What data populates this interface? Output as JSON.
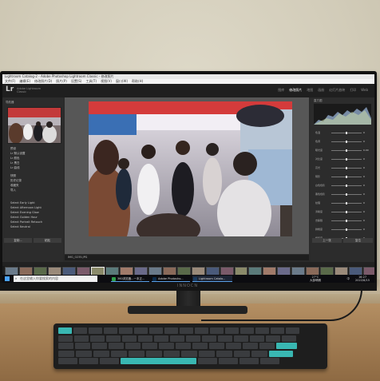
{
  "window": {
    "title": "Lightroom Catalog-2 - Adobe Photoshop Lightroom Classic - 修改照片"
  },
  "menu": [
    "文件(F)",
    "编辑(E)",
    "修改照片(D)",
    "照片(P)",
    "设置(S)",
    "工具(T)",
    "视图(V)",
    "窗口(W)",
    "帮助(H)"
  ],
  "app": {
    "logo": "Lr",
    "subtitle": "Adobe Lightroom Classic",
    "modules": [
      "图库",
      "修改照片",
      "地图",
      "画册",
      "幻灯片放映",
      "打印",
      "Web"
    ],
    "active_module": "修改照片"
  },
  "left_panel": {
    "navigator_label": "导航器",
    "tree": [
      "预设",
      "Lr 默认设置",
      "Lr 颜色",
      "Lr 黑白",
      "Lr 曲线",
      "快照",
      "历史记录",
      "收藏夹",
      "导入",
      "Select Early Light",
      "Select Afternoon Light",
      "Select Evening Glow",
      "Select Golden Hour",
      "Select Portrait Retouch",
      "Select Neutral"
    ],
    "buttons": [
      "复制...",
      "粘贴"
    ]
  },
  "right_panel": {
    "histogram_label": "直方图",
    "sliders": [
      {
        "label": "色温",
        "value": "0"
      },
      {
        "label": "色调",
        "value": "0"
      },
      {
        "label": "曝光度",
        "value": "0.00"
      },
      {
        "label": "对比度",
        "value": "0"
      },
      {
        "label": "高光",
        "value": "0"
      },
      {
        "label": "阴影",
        "value": "0"
      },
      {
        "label": "白色色阶",
        "value": "0"
      },
      {
        "label": "黑色色阶",
        "value": "0"
      },
      {
        "label": "纹理",
        "value": "0"
      },
      {
        "label": "清晰度",
        "value": "0"
      },
      {
        "label": "去朦胧",
        "value": "0"
      },
      {
        "label": "鲜艳度",
        "value": "0"
      },
      {
        "label": "饱和度",
        "value": "0"
      }
    ],
    "buttons": [
      "上一张",
      "复位"
    ]
  },
  "toolbar": {
    "filename": "IMG_0235.JPG"
  },
  "taskbar": {
    "search_placeholder": "在这里输入你要搜索的内容",
    "apps": [
      "360浏览器...一本正...",
      "Adobe Photosho...",
      "Lightroom Catalo..."
    ],
    "temp": "27°C",
    "weather": "大部晴朗",
    "time": "16:27",
    "date": "2022/6/15",
    "lang": "中"
  },
  "monitor": {
    "brand": "INNOCN"
  },
  "colors": {
    "accent": "#4aa3ff",
    "keyboard_accent": "#39b7b2"
  }
}
